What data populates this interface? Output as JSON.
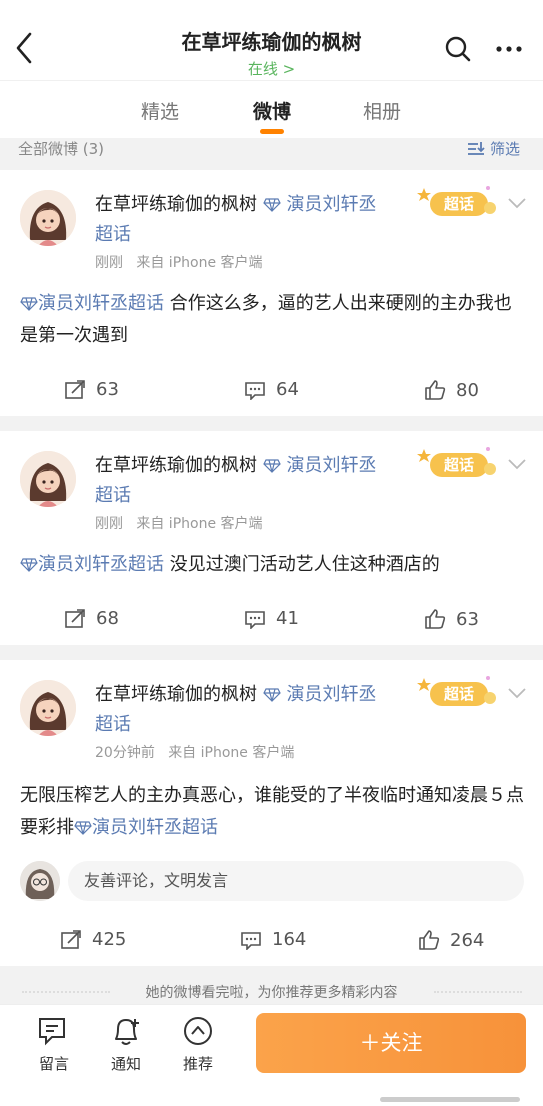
{
  "header": {
    "title": "在草坪练瑜伽的枫树",
    "status": "在线 >"
  },
  "tabs": [
    {
      "label": "精选"
    },
    {
      "label": "微博"
    },
    {
      "label": "相册"
    }
  ],
  "filter": {
    "count_label": "全部微博 (3)",
    "filter_label": "筛选"
  },
  "badge_label": "超话",
  "posts": [
    {
      "username": "在草坪练瑜伽的枫树",
      "tag": "演员刘轩丞超话",
      "time": "刚刚",
      "source": "来自 iPhone 客户端",
      "topic": "演员刘轩丞超话",
      "text": " 合作这么多，逼的艺人出来硬刚的主办我也是第一次遇到",
      "reposts": "63",
      "comments": "64",
      "likes": "80"
    },
    {
      "username": "在草坪练瑜伽的枫树",
      "tag": "演员刘轩丞超话",
      "time": "刚刚",
      "source": "来自 iPhone 客户端",
      "topic": "演员刘轩丞超话",
      "text": " 没见过澳门活动艺人住这种酒店的",
      "reposts": "68",
      "comments": "41",
      "likes": "63"
    },
    {
      "username": "在草坪练瑜伽的枫树",
      "tag": "演员刘轩丞超话",
      "time": "20分钟前",
      "source": "来自 iPhone 客户端",
      "text": "无限压榨艺人的主办真恶心，谁能受的了半夜临时通知凌晨５点要彩排",
      "topic": "演员刘轩丞超话",
      "comment_placeholder": "友善评论，文明发言",
      "reposts": "425",
      "comments": "164",
      "likes": "264"
    }
  ],
  "end_note": "她的微博看完啦，为你推荐更多精彩内容",
  "bottom": {
    "message_label": "留言",
    "notify_label": "通知",
    "recommend_label": "推荐",
    "follow_label": "＋关注"
  },
  "colors": {
    "accent": "#ff8200",
    "link": "#5b7bb2",
    "online": "#5ab55e",
    "follow": "#f7923a"
  },
  "icons": [
    "back-icon",
    "search-icon",
    "more-icon",
    "filter-icon",
    "gem-icon",
    "super-topic-badge",
    "chevron-down-icon",
    "repost-icon",
    "comment-icon",
    "like-icon",
    "message-icon",
    "bell-add-icon",
    "recommend-icon"
  ]
}
